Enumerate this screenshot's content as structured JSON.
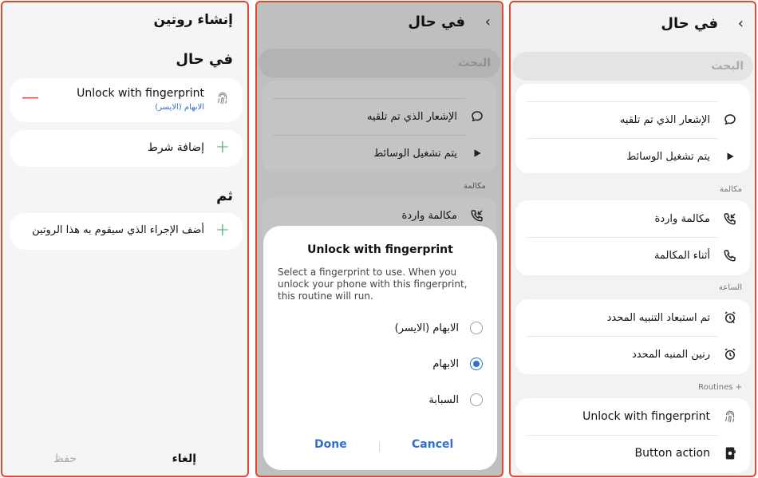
{
  "panel1": {
    "title": "إنشاء روتين",
    "if_heading": "في حال",
    "condition_label": "Unlock with fingerprint",
    "condition_sub": "الابهام (الايسر)",
    "add_condition": "إضافة شرط",
    "then_heading": "ثم",
    "add_action": "أضف الإجراء الذي سيقوم به هذا الروتين",
    "cancel": "إلغاء",
    "save": "حفظ"
  },
  "panel2": {
    "title": "في حال",
    "search": "البحث",
    "items": [
      "الإشعار الذي تم تلقيه",
      "يتم تشغيل الوسائط"
    ],
    "group_call": "مكالمة",
    "call_item": "مكالمة واردة",
    "dialog": {
      "title": "Unlock with fingerprint",
      "description": "Select a fingerprint to use. When you unlock your phone with this fingerprint, this routine will run.",
      "options": [
        "الابهام (الايسر)",
        "الابهام",
        "السبابة"
      ],
      "selected_index": 1,
      "done": "Done",
      "cancel": "Cancel"
    }
  },
  "panel3": {
    "title": "في حال",
    "search": "البحث",
    "items_top": [
      "الإشعار الذي تم تلقيه",
      "يتم تشغيل الوسائط"
    ],
    "group_call": "مكالمة",
    "call_items": [
      "مكالمة واردة",
      "أثناء المكالمة"
    ],
    "group_clock": "الساعة",
    "clock_items": [
      "تم استبعاد التنبيه المحدد",
      "رنين المنبه المحدد"
    ],
    "group_routines": "Routines +",
    "routine_items": [
      "Unlock with fingerprint",
      "Button action"
    ]
  },
  "colors": {
    "border": "#e8452c",
    "accent_blue": "#2f6fd0",
    "accent_green": "#3aa257",
    "accent_red": "#e04b4b"
  }
}
